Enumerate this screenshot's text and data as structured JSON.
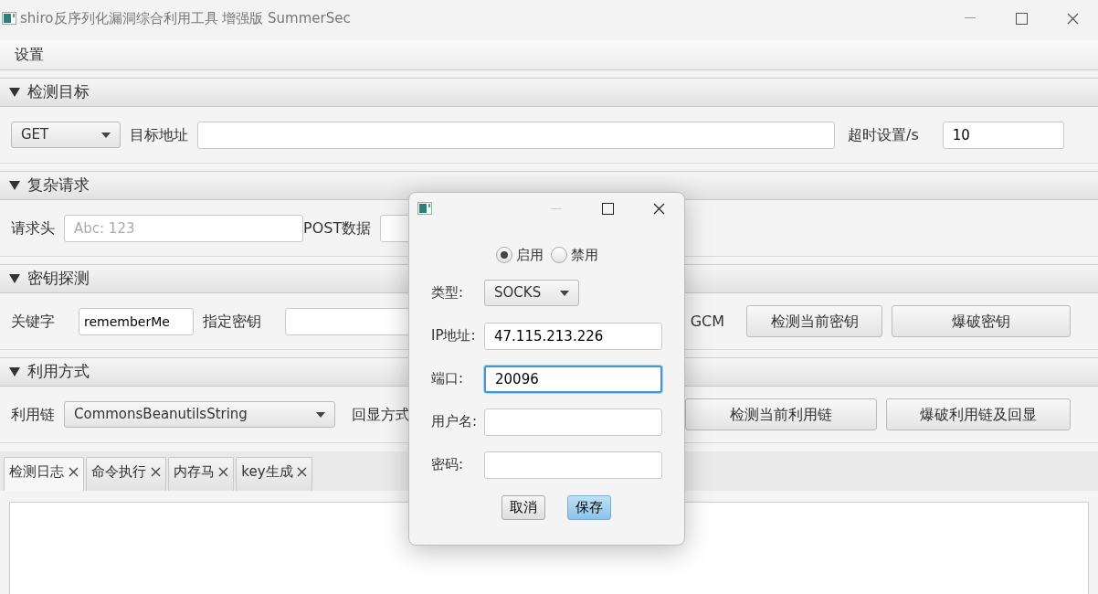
{
  "window": {
    "title": "shiro反序列化漏洞综合利用工具 增强版 SummerSec"
  },
  "menu": [
    "设置"
  ],
  "target": {
    "title": "检测目标",
    "expanded": true,
    "method": "GET",
    "url_label": "目标地址",
    "timeout_label": "超时设置/s",
    "timeout": "10"
  },
  "request": {
    "title": "复杂请求",
    "expanded": true,
    "header_label": "请求头",
    "header_placeholder": "Abc: 123",
    "post_label": "POST数据"
  },
  "key": {
    "title": "密钥探测",
    "expanded": true,
    "keyword_label": "关键字",
    "keyword": "rememberMe",
    "key_label": "指定密钥",
    "gcm_label": "GCM",
    "buttons": [
      "检测当前密钥",
      "爆破密钥"
    ]
  },
  "exploit": {
    "title": "利用方式",
    "expanded": true,
    "chain_label": "利用链",
    "chain": "CommonsBeanutilsString",
    "echo_label": "回显方式",
    "buttons": [
      "检测当前利用链",
      "爆破利用链及回显"
    ]
  },
  "tabs": [
    {
      "label": "检测日志",
      "selected": true
    },
    {
      "label": "命令执行",
      "selected": false
    },
    {
      "label": "内存马",
      "selected": false
    },
    {
      "label": "key生成",
      "selected": false
    }
  ],
  "dialog": {
    "radios": [
      {
        "label": "启用",
        "selected": true
      },
      {
        "label": "禁用",
        "selected": false
      }
    ],
    "type_label": "类型:",
    "type": "SOCKS",
    "fields": [
      {
        "label": "IP地址:",
        "value": "47.115.213.226",
        "focused": false
      },
      {
        "label": "端口:",
        "value": "20096",
        "focused": true
      },
      {
        "label": "用户名:",
        "focused": false
      },
      {
        "label": "密码:",
        "focused": false
      }
    ],
    "buttons": [
      {
        "label": "取消",
        "default": false
      },
      {
        "label": "保存",
        "default": true
      }
    ]
  }
}
